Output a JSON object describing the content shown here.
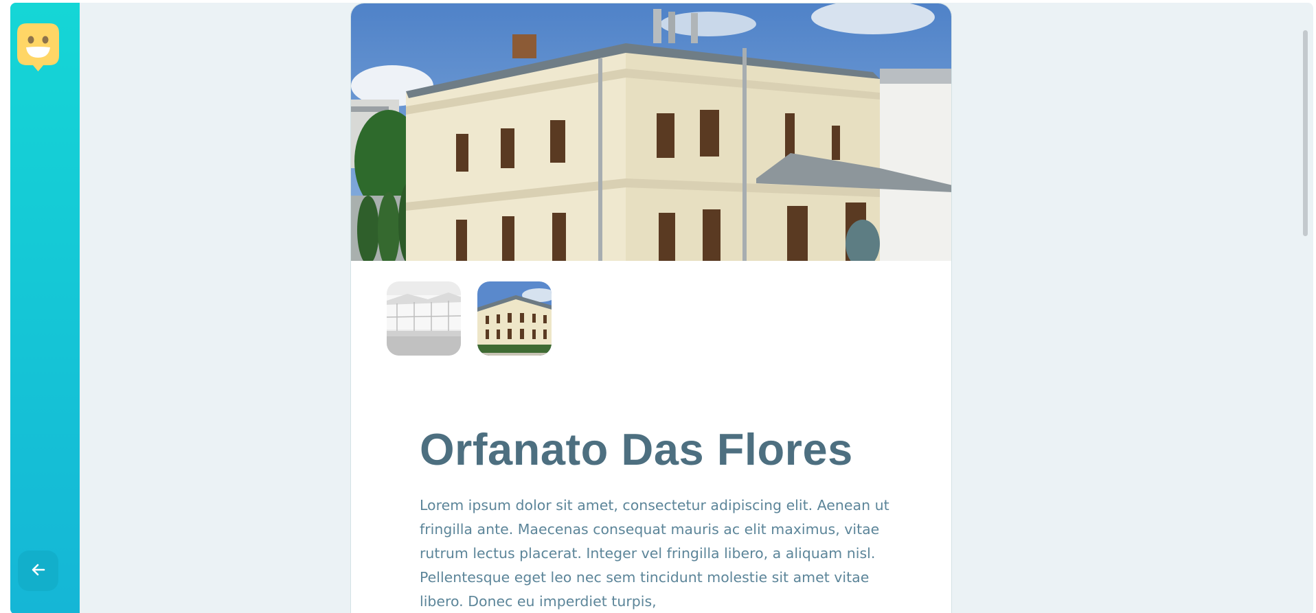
{
  "sidebar": {
    "logo_icon": "smiley-chat-logo-icon",
    "back_icon": "arrow-left-icon",
    "accent_top": "#15d6d6",
    "accent_bottom": "#15b6d6"
  },
  "orphanage": {
    "name": "Orfanato Das Flores",
    "about": "Lorem ipsum dolor sit amet, consectetur adipiscing elit. Aenean ut fringilla ante. Maecenas consequat mauris ac elit maximus, vitae rutrum lectus placerat. Integer vel fringilla libero, a aliquam nisl. Pellentesque eget leo nec sem tincidunt molestie sit amet vitae libero. Donec eu imperdiet turpis,"
  },
  "colors": {
    "title": "#4d6f80",
    "text": "#5c8599",
    "background": "#ebf2f5"
  }
}
